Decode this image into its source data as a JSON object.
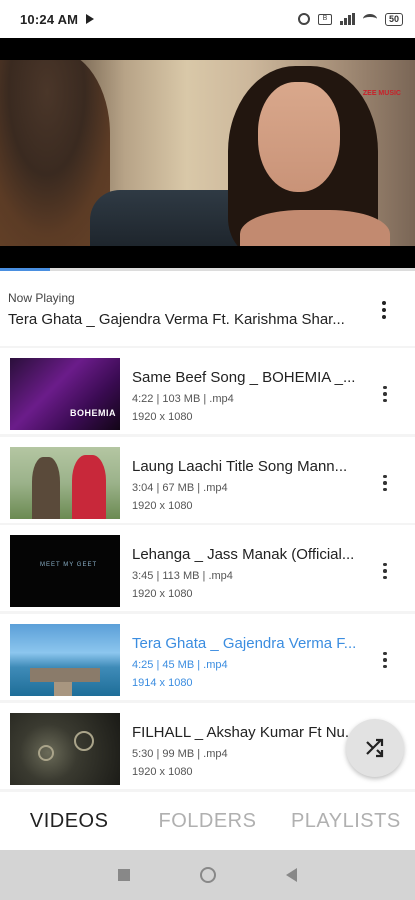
{
  "status_bar": {
    "time": "10:24 AM",
    "battery": "50",
    "sim_box": "B"
  },
  "player": {
    "watermark": "ZEE MUSIC",
    "progress": 0.12
  },
  "now_playing": {
    "label": "Now Playing",
    "title": "Tera Ghata _ Gajendra Verma Ft. Karishma Shar..."
  },
  "videos": [
    {
      "title": "Same Beef Song _ BOHEMIA _...",
      "meta": "4:22 | 103 MB | .mp4",
      "resolution": "1920 x 1080",
      "thumb_text": "BOHEMIA",
      "active": false
    },
    {
      "title": "Laung Laachi Title Song  Mann...",
      "meta": "3:04 | 67 MB | .mp4",
      "resolution": "1920 x 1080",
      "thumb_text": "",
      "active": false
    },
    {
      "title": "Lehanga _ Jass Manak (Official...",
      "meta": "3:45 | 113 MB | .mp4",
      "resolution": "1920 x 1080",
      "thumb_text": "MEET MY GEET",
      "active": false
    },
    {
      "title": "Tera Ghata _ Gajendra Verma F...",
      "meta": "4:25 | 45 MB | .mp4",
      "resolution": "1914 x 1080",
      "thumb_text": "",
      "active": true
    },
    {
      "title": "FILHALL _ Akshay Kumar Ft Nu...",
      "meta": "5:30 | 99 MB | .mp4",
      "resolution": "1920 x 1080",
      "thumb_text": "",
      "active": false
    }
  ],
  "tabs": [
    {
      "label": "VIDEOS",
      "active": true
    },
    {
      "label": "FOLDERS",
      "active": false
    },
    {
      "label": "PLAYLISTS",
      "active": false
    }
  ],
  "colors": {
    "accent": "#3b8de0",
    "active_tab": "#222222",
    "inactive_tab": "#b0b0b0"
  },
  "icons": {
    "fab": "shuffle-icon",
    "nav": [
      "recents-square-icon",
      "home-circle-icon",
      "back-triangle-icon"
    ]
  }
}
